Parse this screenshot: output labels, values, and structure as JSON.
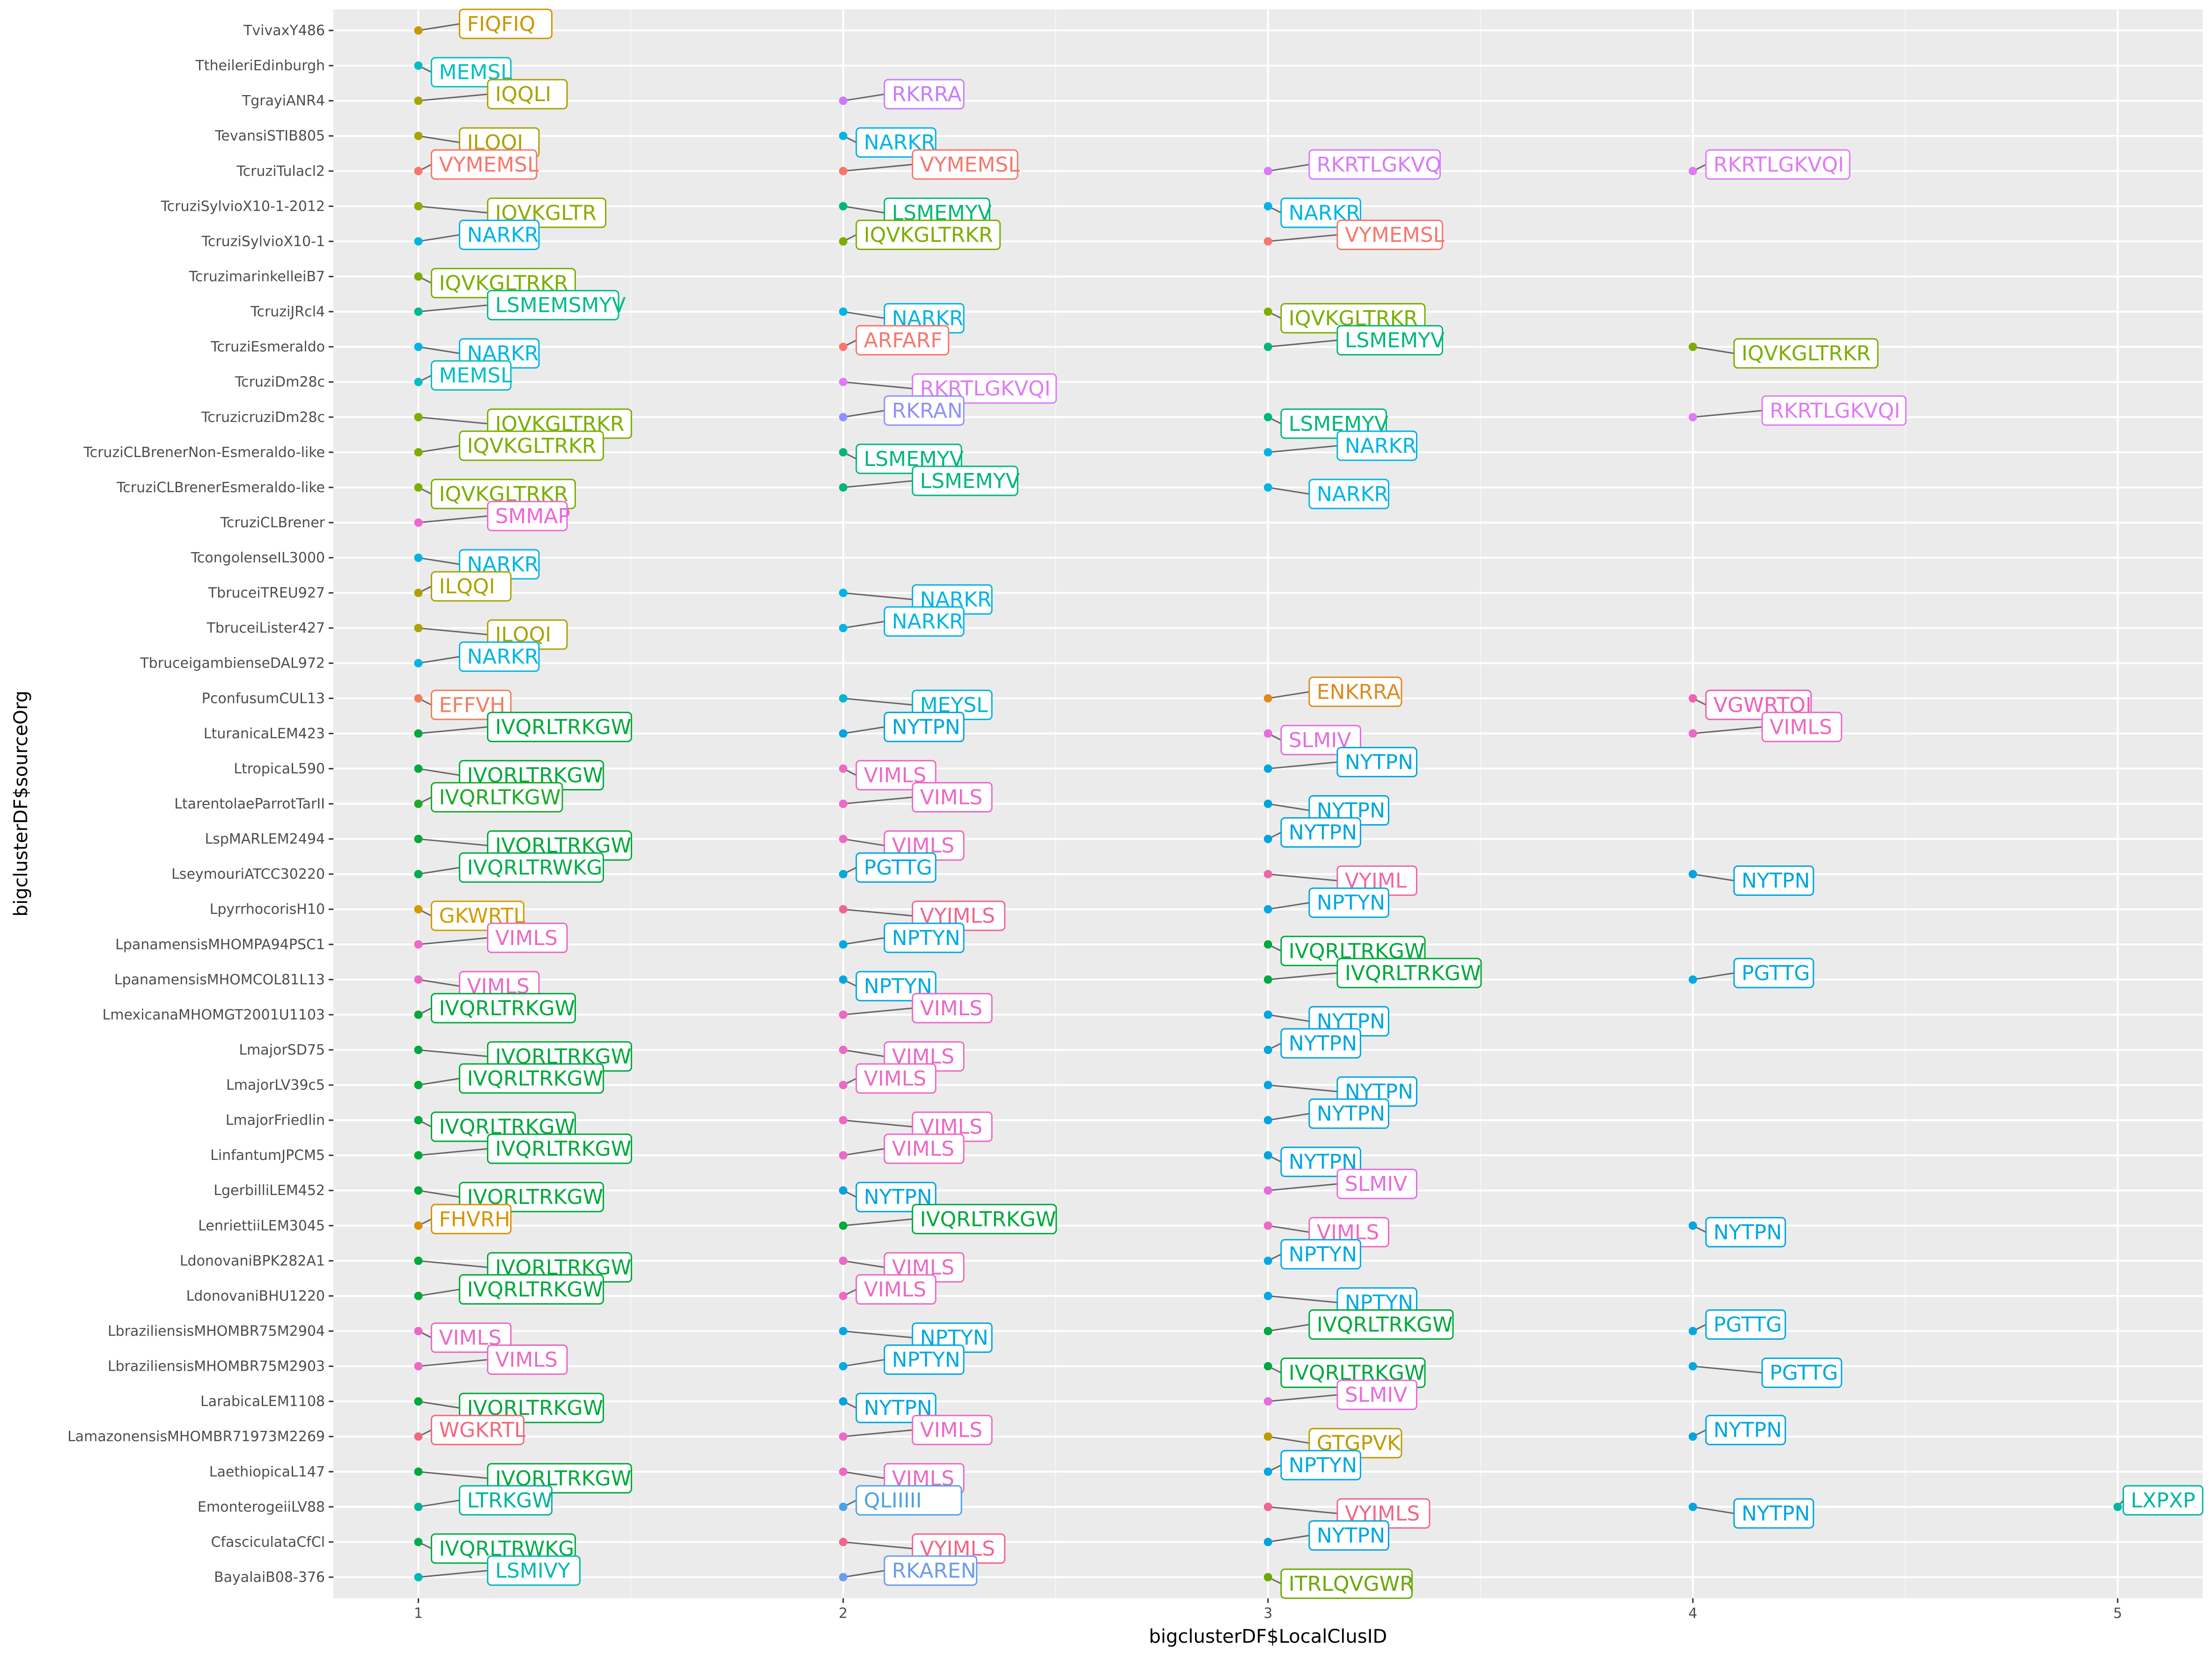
{
  "chart_data": {
    "type": "scatter",
    "xlabel": "bigclusterDF$LocalClusID",
    "ylabel": "bigclusterDF$sourceOrg",
    "xlim": [
      0.8,
      5.2
    ],
    "x_ticks": [
      1,
      2,
      3,
      4,
      5
    ],
    "grid": true,
    "legend": "none",
    "categories": [
      "BayalaiB08-376",
      "CfasciculataCfCl",
      "EmonterogeiiLV88",
      "LaethiopicaL147",
      "LamazonensisMHOMBR71973M2269",
      "LarabicaLEM1108",
      "LbraziliensisMHOMBR75M2903",
      "LbraziliensisMHOMBR75M2904",
      "LdonovaniBHU1220",
      "LdonovaniBPK282A1",
      "LenriettiiLEM3045",
      "LgerbilliLEM452",
      "LinfantumJPCM5",
      "LmajorFriedlin",
      "LmajorLV39c5",
      "LmajorSD75",
      "LmexicanaMHOMGT2001U1103",
      "LpanamensisMHOMCOL81L13",
      "LpanamensisMHOMPA94PSC1",
      "LpyrrhocorisH10",
      "LseymouriATCC30220",
      "LspMARLEM2494",
      "LtarentolaeParrotTarII",
      "LtropicaL590",
      "LturanicaLEM423",
      "PconfusumCUL13",
      "TbruceigambienseDAL972",
      "TbruceiLister427",
      "TbruceiTREU927",
      "TcongolenseIL3000",
      "TcruziCLBrener",
      "TcruziCLBrenerEsmeraldo-like",
      "TcruziCLBrenerNon-Esmeraldo-like",
      "TcruzicruziDm28c",
      "TcruziDm28c",
      "TcruziEsmeraldo",
      "TcruziJRcl4",
      "TcruzimarinkelleiB7",
      "TcruziSylvioX10-1",
      "TcruziSylvioX10-1-2012",
      "TcruziTulacl2",
      "TevansiSTIB805",
      "TgrayiANR4",
      "TtheileriEdinburgh",
      "TvivaxY486"
    ],
    "points": [
      {
        "org": "TvivaxY486",
        "x": 1,
        "label": "FIQFIQ"
      },
      {
        "org": "TtheileriEdinburgh",
        "x": 1,
        "label": "MEMSL"
      },
      {
        "org": "TgrayiANR4",
        "x": 1,
        "label": "IQQLI"
      },
      {
        "org": "TgrayiANR4",
        "x": 2,
        "label": "RKRRA"
      },
      {
        "org": "TevansiSTIB805",
        "x": 1,
        "label": "ILQQI"
      },
      {
        "org": "TevansiSTIB805",
        "x": 2,
        "label": "NARKR"
      },
      {
        "org": "TcruziTulacl2",
        "x": 1,
        "label": "VYMEMSL"
      },
      {
        "org": "TcruziTulacl2",
        "x": 2,
        "label": "VYMEMSL"
      },
      {
        "org": "TcruziTulacl2",
        "x": 3,
        "label": "RKRTLGKVQ"
      },
      {
        "org": "TcruziTulacl2",
        "x": 4,
        "label": "RKRTLGKVQI"
      },
      {
        "org": "TcruziSylvioX10-1-2012",
        "x": 1,
        "label": "IQVKGLTR"
      },
      {
        "org": "TcruziSylvioX10-1-2012",
        "x": 2,
        "label": "LSMEMYV"
      },
      {
        "org": "TcruziSylvioX10-1-2012",
        "x": 3,
        "label": "NARKR"
      },
      {
        "org": "TcruziSylvioX10-1",
        "x": 1,
        "label": "NARKR"
      },
      {
        "org": "TcruziSylvioX10-1",
        "x": 2,
        "label": "IQVKGLTRKR"
      },
      {
        "org": "TcruziSylvioX10-1",
        "x": 3,
        "label": "VYMEMSL"
      },
      {
        "org": "TcruzimarinkelleiB7",
        "x": 1,
        "label": "IQVKGLTRKR"
      },
      {
        "org": "TcruziJRcl4",
        "x": 1,
        "label": "LSMEMSMYV"
      },
      {
        "org": "TcruziJRcl4",
        "x": 2,
        "label": "NARKR"
      },
      {
        "org": "TcruziJRcl4",
        "x": 3,
        "label": "IQVKGLTRKR"
      },
      {
        "org": "TcruziEsmeraldo",
        "x": 1,
        "label": "NARKR"
      },
      {
        "org": "TcruziEsmeraldo",
        "x": 2,
        "label": "ARFARF"
      },
      {
        "org": "TcruziEsmeraldo",
        "x": 3,
        "label": "LSMEMYV"
      },
      {
        "org": "TcruziEsmeraldo",
        "x": 4,
        "label": "IQVKGLTRKR"
      },
      {
        "org": "TcruziDm28c",
        "x": 1,
        "label": "MEMSL"
      },
      {
        "org": "TcruziDm28c",
        "x": 2,
        "label": "RKRTLGKVQI"
      },
      {
        "org": "TcruzicruziDm28c",
        "x": 1,
        "label": "IQVKGLTRKR"
      },
      {
        "org": "TcruzicruziDm28c",
        "x": 2,
        "label": "RKRAN"
      },
      {
        "org": "TcruzicruziDm28c",
        "x": 3,
        "label": "LSMEMYV"
      },
      {
        "org": "TcruzicruziDm28c",
        "x": 4,
        "label": "RKRTLGKVQI"
      },
      {
        "org": "TcruziCLBrenerNon-Esmeraldo-like",
        "x": 1,
        "label": "IQVKGLTRKR"
      },
      {
        "org": "TcruziCLBrenerNon-Esmeraldo-like",
        "x": 2,
        "label": "LSMEMYV"
      },
      {
        "org": "TcruziCLBrenerNon-Esmeraldo-like",
        "x": 3,
        "label": "NARKR"
      },
      {
        "org": "TcruziCLBrenerEsmeraldo-like",
        "x": 1,
        "label": "IQVKGLTRKR"
      },
      {
        "org": "TcruziCLBrenerEsmeraldo-like",
        "x": 2,
        "label": "LSMEMYV"
      },
      {
        "org": "TcruziCLBrenerEsmeraldo-like",
        "x": 3,
        "label": "NARKR"
      },
      {
        "org": "TcruziCLBrener",
        "x": 1,
        "label": "SMMAP"
      },
      {
        "org": "TcongolenseIL3000",
        "x": 1,
        "label": "NARKR"
      },
      {
        "org": "TbruceiTREU927",
        "x": 1,
        "label": "ILQQI"
      },
      {
        "org": "TbruceiTREU927",
        "x": 2,
        "label": "NARKR"
      },
      {
        "org": "TbruceiLister427",
        "x": 1,
        "label": "ILQQI"
      },
      {
        "org": "TbruceiLister427",
        "x": 2,
        "label": "NARKR"
      },
      {
        "org": "TbruceigambienseDAL972",
        "x": 1,
        "label": "NARKR"
      },
      {
        "org": "PconfusumCUL13",
        "x": 1,
        "label": "EFFVH"
      },
      {
        "org": "PconfusumCUL13",
        "x": 2,
        "label": "MEYSL"
      },
      {
        "org": "PconfusumCUL13",
        "x": 3,
        "label": "ENKRRA"
      },
      {
        "org": "PconfusumCUL13",
        "x": 4,
        "label": "VGWRTQI"
      },
      {
        "org": "LturanicaLEM423",
        "x": 1,
        "label": "IVQRLTRKGW"
      },
      {
        "org": "LturanicaLEM423",
        "x": 2,
        "label": "NYTPN"
      },
      {
        "org": "LturanicaLEM423",
        "x": 3,
        "label": "SLMIV"
      },
      {
        "org": "LturanicaLEM423",
        "x": 4,
        "label": "VIMLS"
      },
      {
        "org": "LtropicaL590",
        "x": 1,
        "label": "IVQRLTRKGW"
      },
      {
        "org": "LtropicaL590",
        "x": 2,
        "label": "VIMLS"
      },
      {
        "org": "LtropicaL590",
        "x": 3,
        "label": "NYTPN"
      },
      {
        "org": "LtarentolaeParrotTarII",
        "x": 1,
        "label": "IVQRLTKGW"
      },
      {
        "org": "LtarentolaeParrotTarII",
        "x": 2,
        "label": "VIMLS"
      },
      {
        "org": "LtarentolaeParrotTarII",
        "x": 3,
        "label": "NYTPN"
      },
      {
        "org": "LspMARLEM2494",
        "x": 1,
        "label": "IVQRLTRKGW"
      },
      {
        "org": "LspMARLEM2494",
        "x": 2,
        "label": "VIMLS"
      },
      {
        "org": "LspMARLEM2494",
        "x": 3,
        "label": "NYTPN"
      },
      {
        "org": "LseymouriATCC30220",
        "x": 1,
        "label": "IVQRLTRWKG"
      },
      {
        "org": "LseymouriATCC30220",
        "x": 2,
        "label": "PGTTG"
      },
      {
        "org": "LseymouriATCC30220",
        "x": 3,
        "label": "VYIML"
      },
      {
        "org": "LseymouriATCC30220",
        "x": 4,
        "label": "NYTPN"
      },
      {
        "org": "LpyrrhocorisH10",
        "x": 1,
        "label": "GKWRTL"
      },
      {
        "org": "LpyrrhocorisH10",
        "x": 2,
        "label": "VYIMLS"
      },
      {
        "org": "LpyrrhocorisH10",
        "x": 3,
        "label": "NPTYN"
      },
      {
        "org": "LpanamensisMHOMPA94PSC1",
        "x": 1,
        "label": "VIMLS"
      },
      {
        "org": "LpanamensisMHOMPA94PSC1",
        "x": 2,
        "label": "NPTYN"
      },
      {
        "org": "LpanamensisMHOMPA94PSC1",
        "x": 3,
        "label": "IVQRLTRKGW"
      },
      {
        "org": "LpanamensisMHOMCOL81L13",
        "x": 1,
        "label": "VIMLS"
      },
      {
        "org": "LpanamensisMHOMCOL81L13",
        "x": 2,
        "label": "NPTYN"
      },
      {
        "org": "LpanamensisMHOMCOL81L13",
        "x": 3,
        "label": "IVQRLTRKGW"
      },
      {
        "org": "LpanamensisMHOMCOL81L13",
        "x": 4,
        "label": "PGTTG"
      },
      {
        "org": "LmexicanaMHOMGT2001U1103",
        "x": 1,
        "label": "IVQRLTRKGW"
      },
      {
        "org": "LmexicanaMHOMGT2001U1103",
        "x": 2,
        "label": "VIMLS"
      },
      {
        "org": "LmexicanaMHOMGT2001U1103",
        "x": 3,
        "label": "NYTPN"
      },
      {
        "org": "LmajorSD75",
        "x": 1,
        "label": "IVQRLTRKGW"
      },
      {
        "org": "LmajorSD75",
        "x": 2,
        "label": "VIMLS"
      },
      {
        "org": "LmajorSD75",
        "x": 3,
        "label": "NYTPN"
      },
      {
        "org": "LmajorLV39c5",
        "x": 1,
        "label": "IVQRLTRKGW"
      },
      {
        "org": "LmajorLV39c5",
        "x": 2,
        "label": "VIMLS"
      },
      {
        "org": "LmajorLV39c5",
        "x": 3,
        "label": "NYTPN"
      },
      {
        "org": "LmajorFriedlin",
        "x": 1,
        "label": "IVQRLTRKGW"
      },
      {
        "org": "LmajorFriedlin",
        "x": 2,
        "label": "VIMLS"
      },
      {
        "org": "LmajorFriedlin",
        "x": 3,
        "label": "NYTPN"
      },
      {
        "org": "LinfantumJPCM5",
        "x": 1,
        "label": "IVQRLTRKGW"
      },
      {
        "org": "LinfantumJPCM5",
        "x": 2,
        "label": "VIMLS"
      },
      {
        "org": "LinfantumJPCM5",
        "x": 3,
        "label": "NYTPN"
      },
      {
        "org": "LgerbilliLEM452",
        "x": 1,
        "label": "IVQRLTRKGW"
      },
      {
        "org": "LgerbilliLEM452",
        "x": 2,
        "label": "NYTPN"
      },
      {
        "org": "LgerbilliLEM452",
        "x": 3,
        "label": "SLMIV"
      },
      {
        "org": "LenriettiiLEM3045",
        "x": 1,
        "label": "FHVRH"
      },
      {
        "org": "LenriettiiLEM3045",
        "x": 2,
        "label": "IVQRLTRKGW"
      },
      {
        "org": "LenriettiiLEM3045",
        "x": 3,
        "label": "VIMLS"
      },
      {
        "org": "LenriettiiLEM3045",
        "x": 4,
        "label": "NYTPN"
      },
      {
        "org": "LdonovaniBPK282A1",
        "x": 1,
        "label": "IVQRLTRKGW"
      },
      {
        "org": "LdonovaniBPK282A1",
        "x": 2,
        "label": "VIMLS"
      },
      {
        "org": "LdonovaniBPK282A1",
        "x": 3,
        "label": "NPTYN"
      },
      {
        "org": "LdonovaniBHU1220",
        "x": 1,
        "label": "IVQRLTRKGW"
      },
      {
        "org": "LdonovaniBHU1220",
        "x": 2,
        "label": "VIMLS"
      },
      {
        "org": "LdonovaniBHU1220",
        "x": 3,
        "label": "NPTYN"
      },
      {
        "org": "LbraziliensisMHOMBR75M2904",
        "x": 1,
        "label": "VIMLS"
      },
      {
        "org": "LbraziliensisMHOMBR75M2904",
        "x": 2,
        "label": "NPTYN"
      },
      {
        "org": "LbraziliensisMHOMBR75M2904",
        "x": 3,
        "label": "IVQRLTRKGW"
      },
      {
        "org": "LbraziliensisMHOMBR75M2904",
        "x": 4,
        "label": "PGTTG"
      },
      {
        "org": "LbraziliensisMHOMBR75M2903",
        "x": 1,
        "label": "VIMLS"
      },
      {
        "org": "LbraziliensisMHOMBR75M2903",
        "x": 2,
        "label": "NPTYN"
      },
      {
        "org": "LbraziliensisMHOMBR75M2903",
        "x": 3,
        "label": "IVQRLTRKGW"
      },
      {
        "org": "LbraziliensisMHOMBR75M2903",
        "x": 4,
        "label": "PGTTG"
      },
      {
        "org": "LarabicaLEM1108",
        "x": 1,
        "label": "IVQRLTRKGW"
      },
      {
        "org": "LarabicaLEM1108",
        "x": 2,
        "label": "NYTPN"
      },
      {
        "org": "LarabicaLEM1108",
        "x": 3,
        "label": "SLMIV"
      },
      {
        "org": "LamazonensisMHOMBR71973M2269",
        "x": 1,
        "label": "WGKRTL"
      },
      {
        "org": "LamazonensisMHOMBR71973M2269",
        "x": 2,
        "label": "VIMLS"
      },
      {
        "org": "LamazonensisMHOMBR71973M2269",
        "x": 3,
        "label": "GTGPVK"
      },
      {
        "org": "LamazonensisMHOMBR71973M2269",
        "x": 4,
        "label": "NYTPN"
      },
      {
        "org": "LaethiopicaL147",
        "x": 1,
        "label": "IVQRLTRKGW"
      },
      {
        "org": "LaethiopicaL147",
        "x": 2,
        "label": "VIMLS"
      },
      {
        "org": "LaethiopicaL147",
        "x": 3,
        "label": "NPTYN"
      },
      {
        "org": "EmonterogeiiLV88",
        "x": 1,
        "label": "LTRKGW"
      },
      {
        "org": "EmonterogeiiLV88",
        "x": 2,
        "label": "QLIIIII"
      },
      {
        "org": "EmonterogeiiLV88",
        "x": 3,
        "label": "VYIMLS"
      },
      {
        "org": "EmonterogeiiLV88",
        "x": 4,
        "label": "NYTPN"
      },
      {
        "org": "EmonterogeiiLV88",
        "x": 5,
        "label": "LXPXP"
      },
      {
        "org": "CfasciculataCfCl",
        "x": 1,
        "label": "IVQRLTRWKG"
      },
      {
        "org": "CfasciculataCfCl",
        "x": 2,
        "label": "VYIMLS"
      },
      {
        "org": "CfasciculataCfCl",
        "x": 3,
        "label": "NYTPN"
      },
      {
        "org": "BayalaiB08-376",
        "x": 1,
        "label": "LSMIVY"
      },
      {
        "org": "BayalaiB08-376",
        "x": 2,
        "label": "RKAREN"
      },
      {
        "org": "BayalaiB08-376",
        "x": 3,
        "label": "ITRLQVGWR"
      }
    ],
    "label_colors": {
      "FIQFIQ": "#CD9600",
      "MEMSL": "#00BFC4",
      "IQQLI": "#ABA300",
      "ILQQI": "#ABA300",
      "RKRRA": "#C77CFF",
      "NARKR": "#00B4E6",
      "VYMEMSL": "#F8766D",
      "RKRTLGKVQ": "#D77BFA",
      "RKRTLGKVQI": "#E07AF5",
      "IQVKGLTR": "#8EAB00",
      "IQVKGLTRKR": "#7CAE00",
      "LSMEMYV": "#00B877",
      "LSMEMSMYV": "#00BB8A",
      "ARFARF": "#F8766D",
      "RKRAN": "#8F91FF",
      "SMMAP": "#F264D8",
      "EFFVH": "#F07F5E",
      "MEYSL": "#00B4D4",
      "ENKRRA": "#E08A1E",
      "VGWRTQI": "#F060B8",
      "IVQRLTRKGW": "#00A93C",
      "IVQRLTKGW": "#1EAA2A",
      "IVQRLTRWKG": "#00AD4A",
      "NYTPN": "#00A5E0",
      "NPTYN": "#00A9E4",
      "SLMIV": "#E86BE0",
      "VIMLS": "#EC69C6",
      "VYIML": "#F066A8",
      "VYIMLS": "#F0668C",
      "PGTTG": "#00A9DE",
      "GKWRTL": "#D39B00",
      "FHVRH": "#D89200",
      "WGKRTL": "#F3697E",
      "GTGPVK": "#BD9C00",
      "LTRKGW": "#00B29A",
      "QLIIIII": "#4AA3E8",
      "LXPXP": "#00B5A4",
      "LSMIVY": "#00B9B6",
      "RKAREN": "#6C9CF0",
      "ITRLQVGWR": "#6AAA00"
    }
  }
}
